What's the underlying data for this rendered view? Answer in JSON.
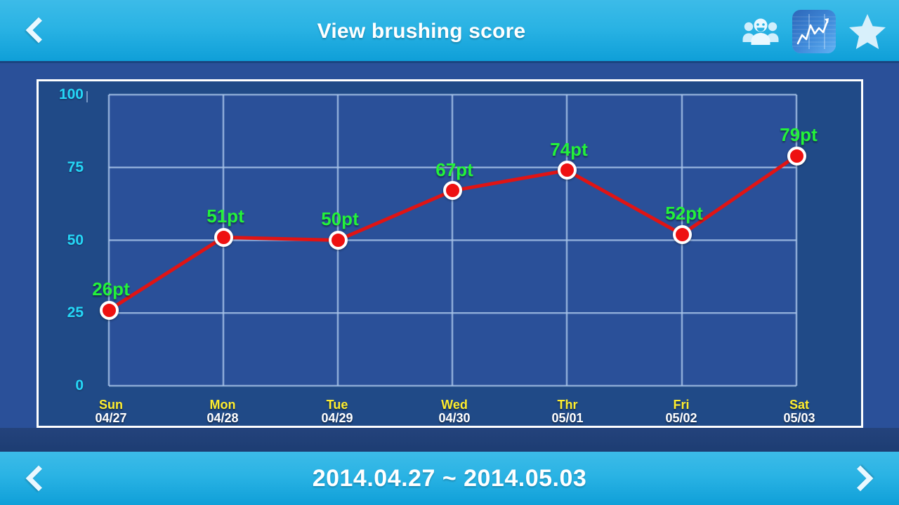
{
  "header": {
    "title": "View brushing score",
    "back_icon": "chevron-left-icon",
    "actions": [
      {
        "name": "users-icon",
        "label": "Users"
      },
      {
        "name": "chart-icon",
        "label": "Chart"
      },
      {
        "name": "star-icon",
        "label": "Favorite"
      }
    ]
  },
  "footer": {
    "range": "2014.04.27 ~ 2014.05.03",
    "prev_icon": "chevron-left-icon",
    "next_icon": "chevron-right-icon"
  },
  "colors": {
    "header_top": "#3cbbe8",
    "header_bottom": "#0f9fd8",
    "panel_bg": "#204a87",
    "plot_bg": "#2a5099",
    "grid": "#a8c4e8",
    "line": "#e01414",
    "marker_fill": "#ee1111",
    "marker_ring": "#ffffff",
    "y_tick": "#25d7f7",
    "x_day": "#ffee2e",
    "x_date": "#ffffff",
    "value_label": "#23f23a"
  },
  "chart_data": {
    "type": "line",
    "title": "View brushing score",
    "xlabel": "",
    "ylabel": "",
    "ylim": [
      0,
      100
    ],
    "yticks": [
      0,
      25,
      50,
      75,
      100
    ],
    "ytick_labels": [
      "0",
      "25",
      "50",
      "75",
      "100"
    ],
    "grid": true,
    "legend": "none",
    "unit": "pt",
    "categories": [
      "Sun",
      "Mon",
      "Tue",
      "Wed",
      "Thr",
      "Fri",
      "Sat"
    ],
    "dates": [
      "04/27",
      "04/28",
      "04/29",
      "04/30",
      "05/01",
      "05/02",
      "05/03"
    ],
    "values": [
      26,
      51,
      50,
      67,
      74,
      52,
      79
    ],
    "point_labels": [
      "26pt",
      "51pt",
      "50pt",
      "67pt",
      "74pt",
      "52pt",
      "79pt"
    ],
    "series": [
      {
        "name": "Brushing score",
        "values": [
          26,
          51,
          50,
          67,
          74,
          52,
          79
        ]
      }
    ]
  }
}
